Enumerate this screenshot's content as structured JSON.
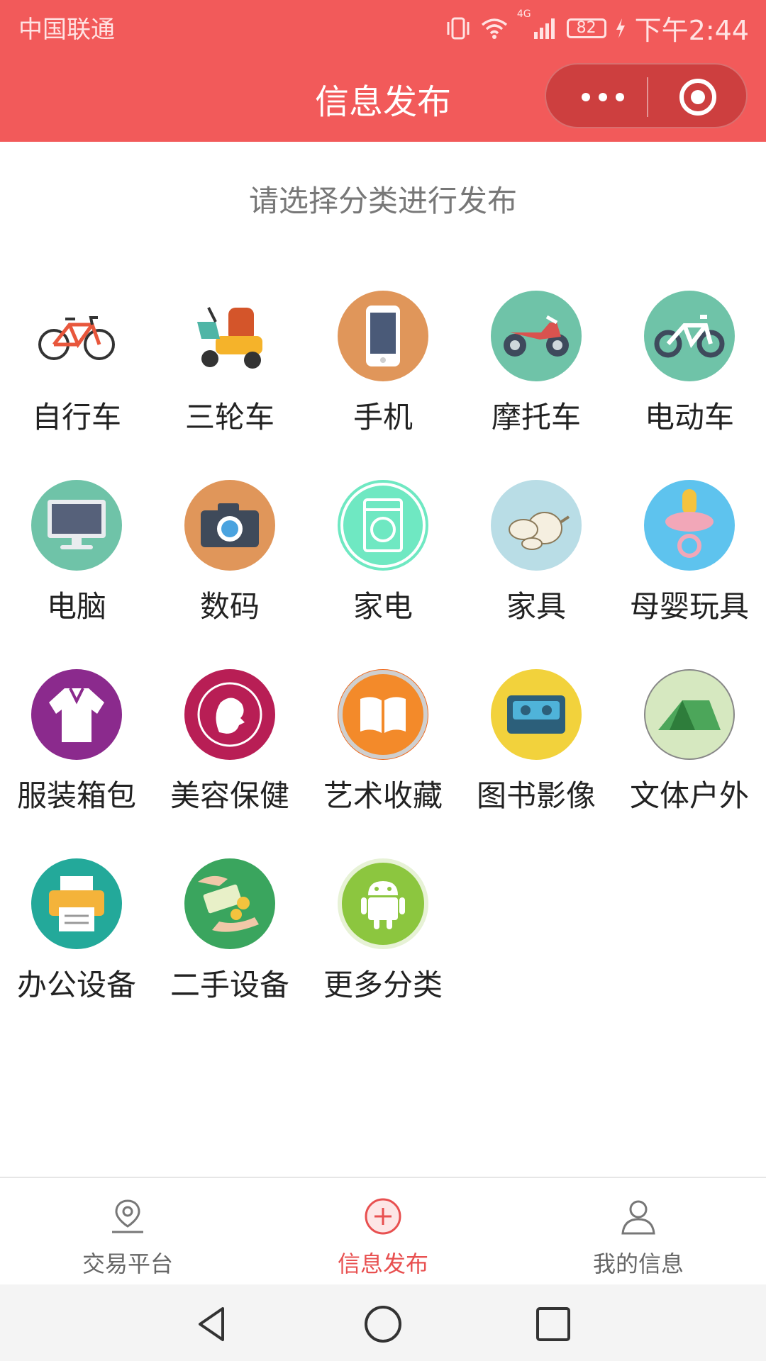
{
  "status_bar": {
    "carrier": "中国联通",
    "network": "4G",
    "battery": "82",
    "time": "下午2:44"
  },
  "header": {
    "title": "信息发布",
    "menu_icon": "more-dots-icon",
    "close_icon": "target-circle-icon"
  },
  "subtitle": "请选择分类进行发布",
  "categories": [
    {
      "label": "自行车",
      "icon": "bicycle-icon",
      "color": "#ffffff"
    },
    {
      "label": "三轮车",
      "icon": "tricycle-icon",
      "color": "#ffffff"
    },
    {
      "label": "手机",
      "icon": "phone-icon",
      "color": "#e0965a"
    },
    {
      "label": "摩托车",
      "icon": "motorcycle-icon",
      "color": "#6fc3a8"
    },
    {
      "label": "电动车",
      "icon": "ebike-icon",
      "color": "#6fc3a8"
    },
    {
      "label": "电脑",
      "icon": "computer-icon",
      "color": "#6fc3a8"
    },
    {
      "label": "数码",
      "icon": "camera-icon",
      "color": "#e0965a"
    },
    {
      "label": "家电",
      "icon": "washing-machine-icon",
      "color": "#6fe8c2"
    },
    {
      "label": "家具",
      "icon": "teapot-icon",
      "color": "#b9dde6"
    },
    {
      "label": "母婴玩具",
      "icon": "pacifier-icon",
      "color": "#5ec3ee"
    },
    {
      "label": "服装箱包",
      "icon": "clothing-icon",
      "color": "#8b2a8d"
    },
    {
      "label": "美容保健",
      "icon": "beauty-icon",
      "color": "#b81e55"
    },
    {
      "label": "艺术收藏",
      "icon": "book-icon",
      "color": "#ee6a1e"
    },
    {
      "label": "图书影像",
      "icon": "cassette-icon",
      "color": "#f2d23c"
    },
    {
      "label": "文体户外",
      "icon": "tent-icon",
      "color": "#d6e8c0"
    },
    {
      "label": "办公设备",
      "icon": "printer-icon",
      "color": "#23a99a"
    },
    {
      "label": "二手设备",
      "icon": "money-hands-icon",
      "color": "#3aa55e"
    },
    {
      "label": "更多分类",
      "icon": "android-icon",
      "color": "#8cc63f"
    }
  ],
  "tabs": [
    {
      "label": "交易平台",
      "icon": "location-pin-icon"
    },
    {
      "label": "信息发布",
      "icon": "add-circle-icon"
    },
    {
      "label": "我的信息",
      "icon": "user-icon"
    }
  ],
  "colors": {
    "header_bg": "#f25a5a",
    "tab_active": "#e85050",
    "tab_inactive": "#666666"
  }
}
